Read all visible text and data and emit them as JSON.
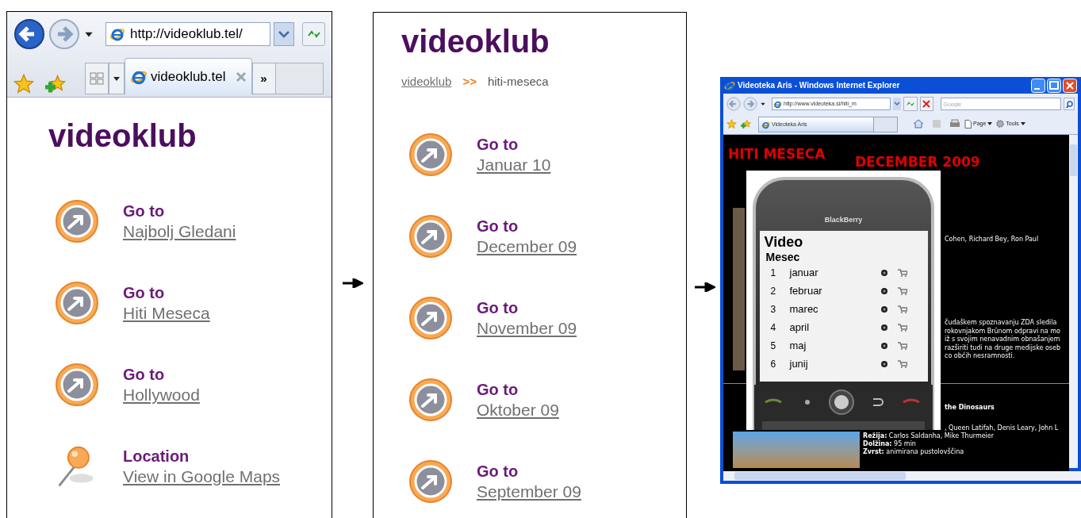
{
  "browser_1": {
    "address": "http://videoklub.tel/",
    "tabs": [
      {
        "title": "videoklub.tel",
        "selected": true
      }
    ],
    "more_tabs": "»",
    "page": {
      "title": "videoklub",
      "items": [
        {
          "kind": "goto",
          "label": "Go to",
          "link": "Najbolj Gledani"
        },
        {
          "kind": "goto",
          "label": "Go to",
          "link": "Hiti Meseca"
        },
        {
          "kind": "goto",
          "label": "Go to",
          "link": "Hollywood"
        },
        {
          "kind": "location",
          "label": "Location",
          "link": "View in Google Maps"
        }
      ]
    }
  },
  "page_2": {
    "title": "videoklub",
    "breadcrumb": [
      {
        "kind": "link",
        "text": "videoklub"
      },
      {
        "kind": "separator",
        "text": ">>"
      },
      {
        "kind": "current",
        "text": "hiti-meseca"
      }
    ],
    "items": [
      {
        "kind": "goto",
        "label": "Go to",
        "link": "Januar 10"
      },
      {
        "kind": "goto",
        "label": "Go to",
        "link": "December 09"
      },
      {
        "kind": "goto",
        "label": "Go to",
        "link": "November 09"
      },
      {
        "kind": "goto",
        "label": "Go to",
        "link": "Oktober 09"
      },
      {
        "kind": "goto",
        "label": "Go to",
        "link": "September 09"
      }
    ]
  },
  "browser_3": {
    "window_title": "Videoteka Aris - Windows Internet Explorer",
    "address": "http://www.videoteka.si/hiti_m",
    "search": {
      "placeholder": "Google"
    },
    "tabs": [
      {
        "title": "Videoteka Aris",
        "selected": true
      }
    ],
    "commands": [
      "Page",
      "Tools"
    ],
    "page": {
      "heading": "HITI MESECA",
      "subheading": "DECEMBER 2009",
      "phone": {
        "brand": "BlackBerry",
        "title": "Video",
        "subtitle": "Mesec",
        "rows": [
          {
            "number": "1",
            "month": "januar"
          },
          {
            "number": "2",
            "month": "februar"
          },
          {
            "number": "3",
            "month": "marec"
          },
          {
            "number": "4",
            "month": "april"
          },
          {
            "number": "5",
            "month": "maj"
          },
          {
            "number": "6",
            "month": "junij"
          }
        ]
      },
      "cast_1": "Cohen, Richard Bey, Ron Paul",
      "description_lines": [
        "čudaškem spoznavanju ZDA sledila",
        "rokovnjakom Brünom odpravi na mo",
        "iž s svojim nenavadnim obnašanjem",
        "razširiti tudi na druge medijske oseb",
        "co obćih nesramnosti."
      ],
      "movie_title": "the Dinosaurs",
      "cast_2": ", Queen Latifah, Denis Leary, John L",
      "details": [
        "**Režija:** Carlos Saldanha, Mike Thurmeier",
        "**Dolžina:** 95 min",
        "**Zvrst:** animirana pustolovščina"
      ]
    }
  }
}
